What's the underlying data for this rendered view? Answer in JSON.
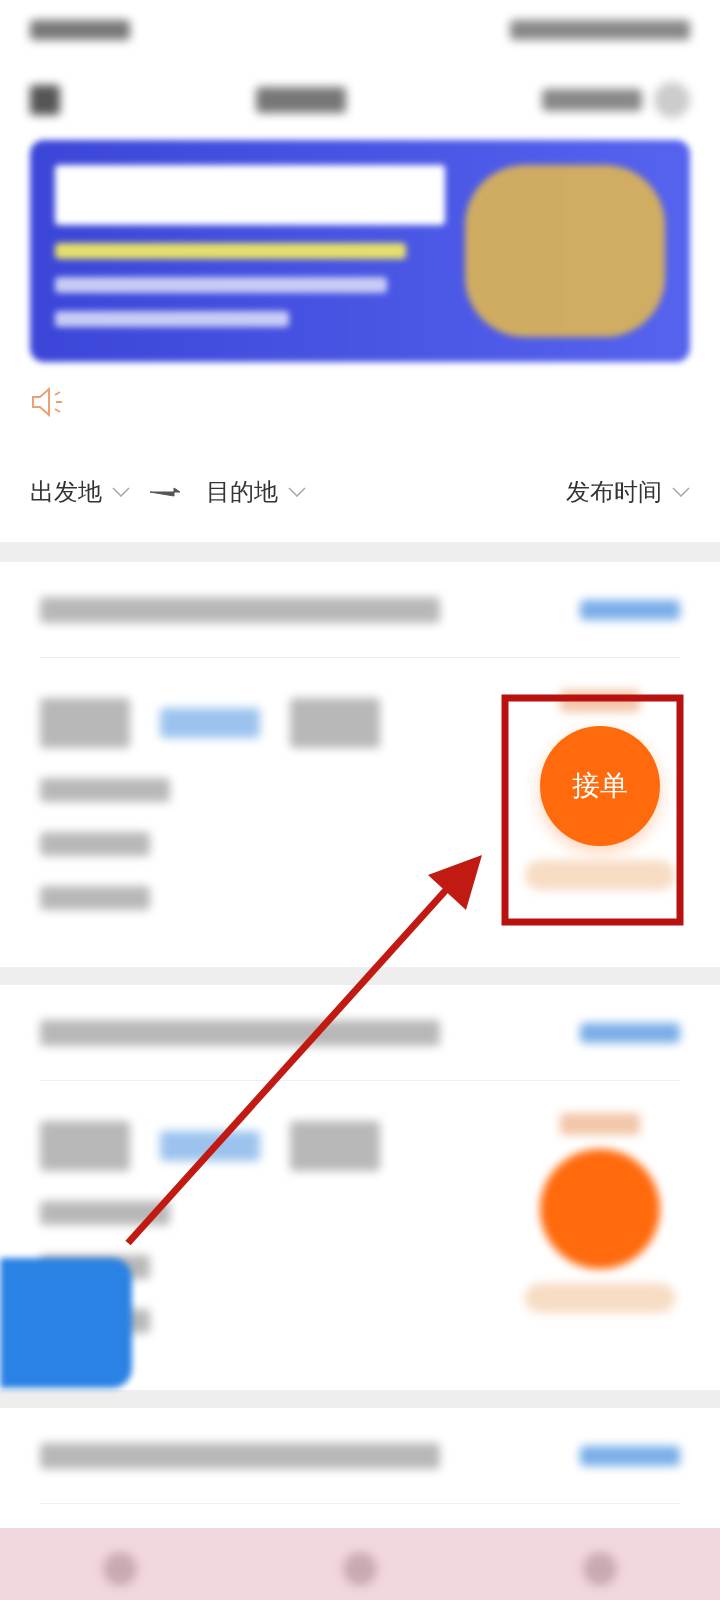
{
  "filters": [
    {
      "label": "出发地",
      "kind": "dropdown"
    },
    {
      "kind": "arrow"
    },
    {
      "label": "目的地",
      "kind": "dropdown"
    },
    {
      "label": "发布时间",
      "kind": "dropdown"
    }
  ],
  "orders": [
    {
      "kind": "full",
      "button_label": "接单"
    },
    {
      "kind": "full"
    },
    {
      "kind": "header"
    }
  ],
  "annotation": {
    "kind": "box_and_arrow"
  }
}
